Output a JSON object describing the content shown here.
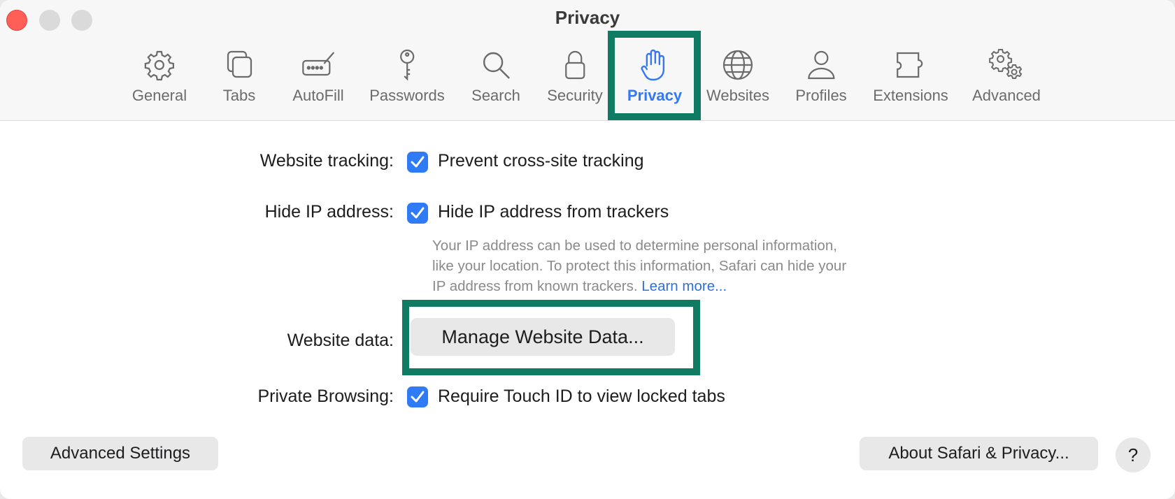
{
  "window": {
    "title": "Privacy"
  },
  "toolbar": {
    "tabs": [
      {
        "label": "General",
        "icon": "gear-icon"
      },
      {
        "label": "Tabs",
        "icon": "tabs-icon"
      },
      {
        "label": "AutoFill",
        "icon": "autofill-icon"
      },
      {
        "label": "Passwords",
        "icon": "key-icon"
      },
      {
        "label": "Search",
        "icon": "search-icon"
      },
      {
        "label": "Security",
        "icon": "lock-icon"
      },
      {
        "label": "Privacy",
        "icon": "hand-icon",
        "active": true
      },
      {
        "label": "Websites",
        "icon": "globe-icon"
      },
      {
        "label": "Profiles",
        "icon": "person-icon"
      },
      {
        "label": "Extensions",
        "icon": "puzzle-icon"
      },
      {
        "label": "Advanced",
        "icon": "gears-icon"
      }
    ]
  },
  "settings": {
    "tracking": {
      "label": "Website tracking:",
      "option": "Prevent cross-site tracking",
      "checked": true
    },
    "hide_ip": {
      "label": "Hide IP address:",
      "option": "Hide IP address from trackers",
      "checked": true,
      "description": [
        "Your IP address can be used to determine personal information,",
        "like your location. To protect this information, Safari can hide your",
        "IP address from known trackers."
      ],
      "learn_more": "Learn more..."
    },
    "website_data": {
      "label": "Website data:",
      "button": "Manage Website Data..."
    },
    "private_browsing": {
      "label": "Private Browsing:",
      "option": "Require Touch ID to view locked tabs",
      "checked": true
    }
  },
  "footer": {
    "advanced_button": "Advanced Settings",
    "about_button": "About Safari & Privacy...",
    "help_button": "?"
  },
  "colors": {
    "accent": "#3478f6",
    "highlight": "#0f7b62",
    "close": "#ff5f57"
  }
}
